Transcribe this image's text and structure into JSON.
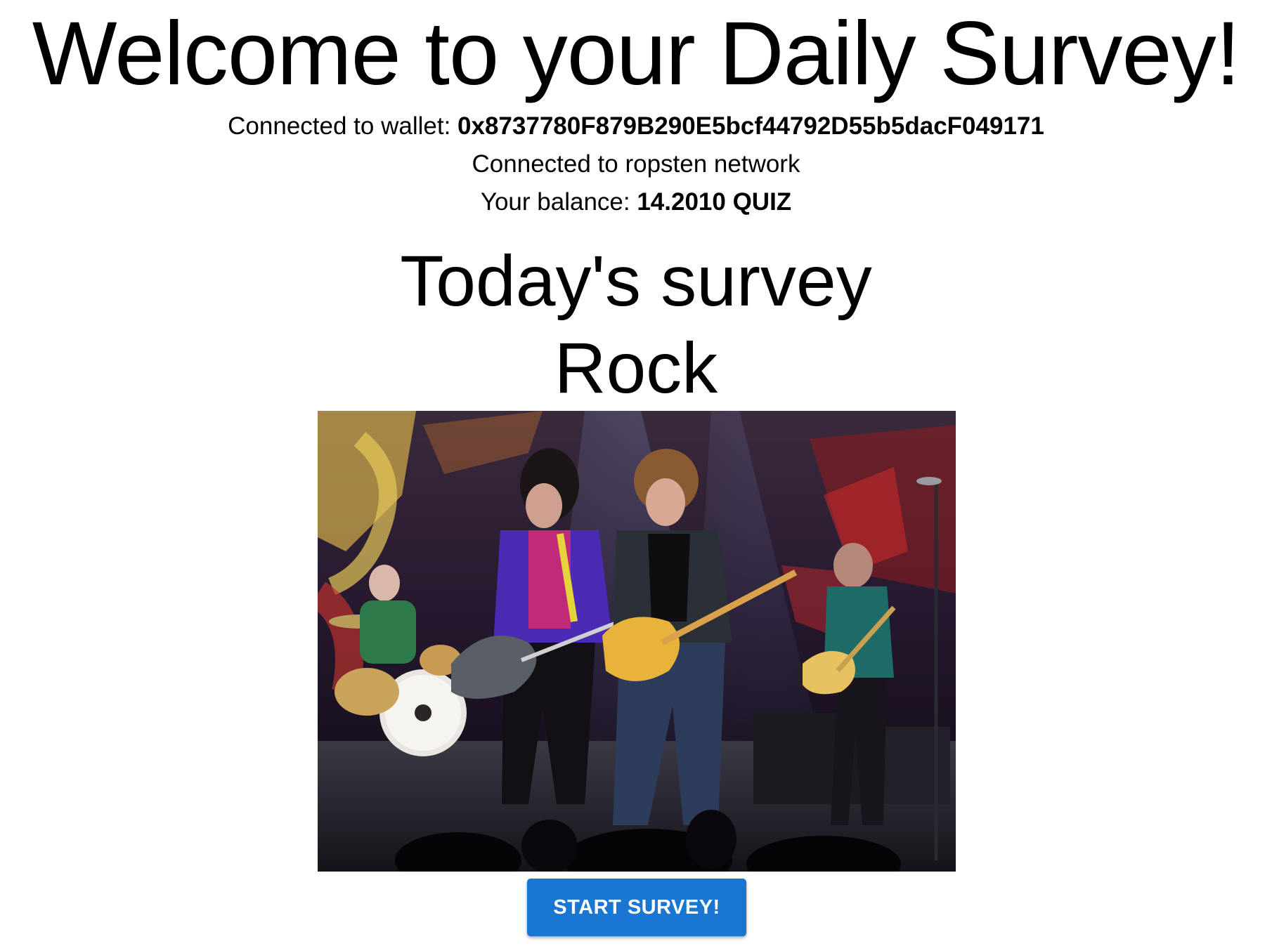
{
  "header": {
    "title": "Welcome to your Daily Survey!"
  },
  "wallet": {
    "label": "Connected to wallet: ",
    "address": "0x8737780F879B290E5bcf44792D55b5dacF049171"
  },
  "network": {
    "text": "Connected to ropsten network"
  },
  "balance": {
    "label": "Your balance: ",
    "value": "14.2010 QUIZ"
  },
  "survey": {
    "heading": "Today's survey",
    "topic": "Rock",
    "image_description": "rock-band-concert-photo",
    "start_label": "START SURVEY!"
  },
  "colors": {
    "button": "#1976d2",
    "button_text": "#ffffff"
  }
}
